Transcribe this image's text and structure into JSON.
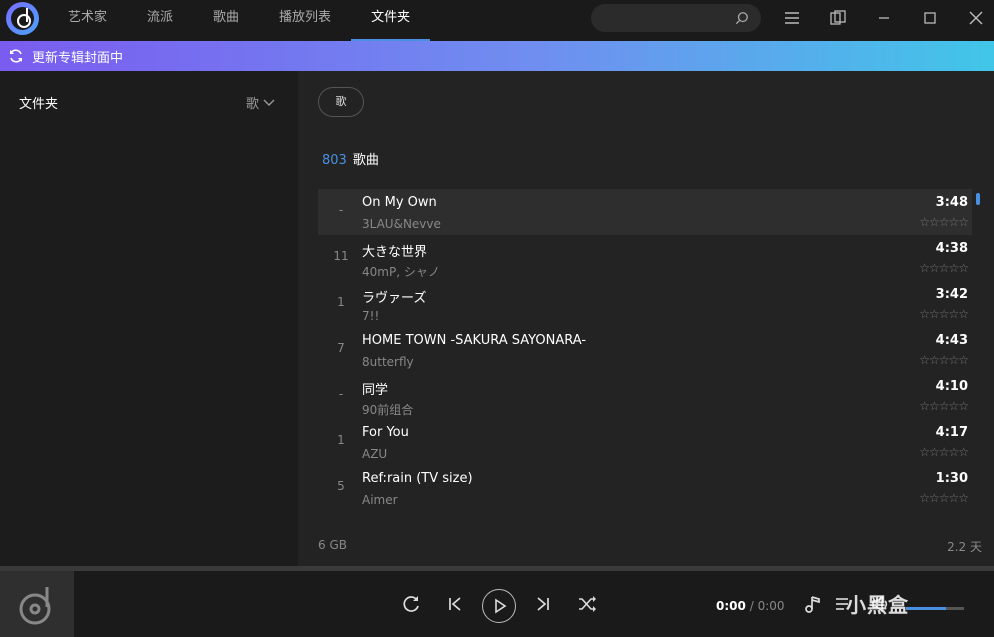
{
  "nav": {
    "tabs": [
      {
        "label": "艺术家"
      },
      {
        "label": "流派"
      },
      {
        "label": "歌曲"
      },
      {
        "label": "播放列表"
      },
      {
        "label": "文件夹"
      }
    ],
    "active": "文件夹"
  },
  "search": {
    "placeholder": ""
  },
  "banner": {
    "text": "更新专辑封面中"
  },
  "sidebar": {
    "title": "文件夹",
    "sort_label": "歌"
  },
  "main": {
    "filter_chip": "歌",
    "count": "803",
    "count_label": "歌曲",
    "songs": [
      {
        "no": "-",
        "title": "On My Own",
        "artist": "3LAU&Nevve",
        "duration": "3:48"
      },
      {
        "no": "11",
        "title": "大きな世界",
        "artist": "40mP, シャノ",
        "duration": "4:38"
      },
      {
        "no": "1",
        "title": "ラヴァーズ",
        "artist": "7!!",
        "duration": "3:42"
      },
      {
        "no": "7",
        "title": "HOME TOWN -SAKURA SAYONARA-",
        "artist": "8utterfly",
        "duration": "4:43"
      },
      {
        "no": "-",
        "title": "同学",
        "artist": "90前组合",
        "duration": "4:10"
      },
      {
        "no": "1",
        "title": "For You",
        "artist": "AZU",
        "duration": "4:17"
      },
      {
        "no": "5",
        "title": "Ref:rain (TV size)",
        "artist": "Aimer",
        "duration": "1:30"
      }
    ],
    "rating_stars": "☆☆☆☆☆",
    "footer_size": "6 GB",
    "footer_total": "2.2 天"
  },
  "player": {
    "current_time": "0:00",
    "separator": "/",
    "total_time": "0:00",
    "watermark": "小黑盒"
  },
  "colors": {
    "accent": "#4a90e2",
    "banner_start": "#7a5cf0",
    "banner_end": "#41c6e8"
  }
}
